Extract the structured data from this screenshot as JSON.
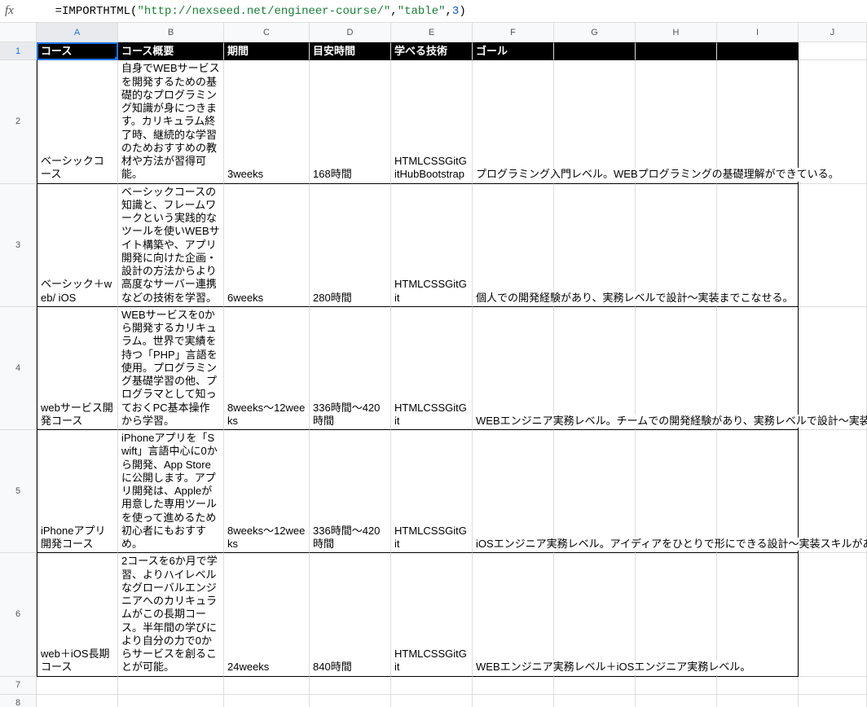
{
  "formula": {
    "fx": "fx",
    "eq": "=",
    "func": "IMPORTHTML",
    "open": "(",
    "arg1": "\"http://nexseed.net/engineer-course/\"",
    "comma1": ",",
    "arg2": "\"table\"",
    "comma2": ",",
    "arg3": "3",
    "close": ")"
  },
  "columns": [
    "A",
    "B",
    "C",
    "D",
    "E",
    "F",
    "G",
    "H",
    "I",
    "J"
  ],
  "rowNumbers": [
    "1",
    "2",
    "3",
    "4",
    "5",
    "6",
    "7",
    "8"
  ],
  "header": {
    "A": "コース",
    "B": "コース概要",
    "C": "期間",
    "D": "目安時間",
    "E": "学べる技術",
    "F": "ゴール"
  },
  "rows": [
    {
      "A": "ベーシックコース",
      "B": "自身でWEBサービスを開発するための基礎的なプログラミング知識が身につきます。カリキュラム終了時、継続的な学習のためおすすめの教材や方法が習得可能。",
      "C": "3weeks",
      "D": "168時間",
      "E": "HTMLCSSGitGitHubBootstrap",
      "F": "プログラミング入門レベル。WEBプログラミングの基礎理解ができている。"
    },
    {
      "A": "ベーシック＋web/ iOS",
      "B": "ベーシックコースの知識と、フレームワークという実践的なツールを使いWEBサイト構築や、アプリ開発に向けた企画・設計の方法からより高度なサーバー連携などの技術を学習。",
      "C": "6weeks",
      "D": "280時間",
      "E": "HTMLCSSGitGit",
      "F": "個人での開発経験があり、実務レベルで設計〜実装までこなせる。"
    },
    {
      "A": "webサービス開発コース",
      "B": "WEBサービスを0から開発するカリキュラム。世界で実績を持つ「PHP」言語を使用。プログラミング基礎学習の他、プログラマとして知っておくPC基本操作から学習。",
      "C": "8weeks〜12weeks",
      "D": "336時間〜420時間",
      "E": "HTMLCSSGitGit",
      "F": "WEBエンジニア実務レベル。チームでの開発経験があり、実務レベルで設計〜実装までこなせる。"
    },
    {
      "A": "iPhoneアプリ開発コース",
      "B": "iPhoneアプリを「Swift」言語中心に0から開発、App Storeに公開します。アプリ開発は、Appleが用意した専用ツールを使って進めるため初心者にもおすすめ。",
      "C": "8weeks〜12weeks",
      "D": "336時間〜420時間",
      "E": "HTMLCSSGitGit",
      "F": "iOSエンジニア実務レベル。アイディアをひとりで形にできる設計〜実装スキルがある。"
    },
    {
      "A": "web＋iOS長期コース",
      "B": "2コースを6か月で学習、よりハイレベルなグローバルエンジニアへのカリキュラムがこの長期コース。半年間の学びにより自分の力で0からサービスを創ることが可能。",
      "C": "24weeks",
      "D": "840時間",
      "E": "HTMLCSSGitGit",
      "F": "WEBエンジニア実務レベル＋iOSエンジニア実務レベル。"
    }
  ]
}
